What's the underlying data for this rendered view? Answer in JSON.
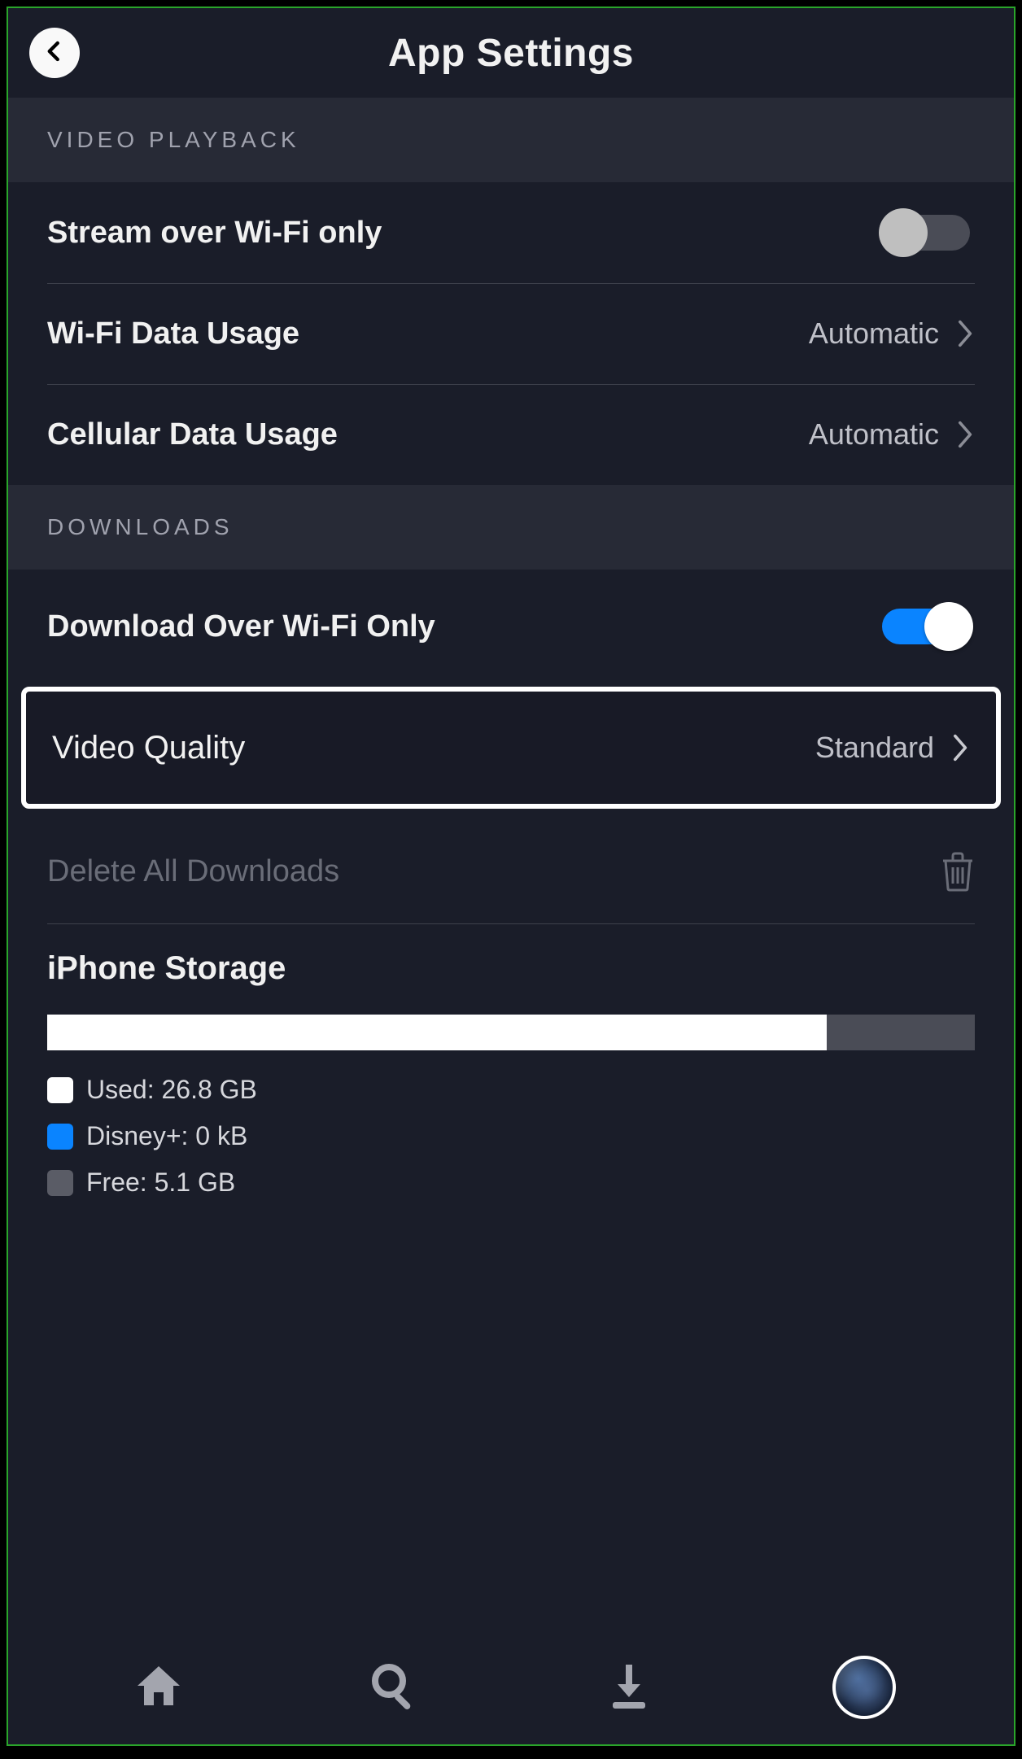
{
  "header": {
    "title": "App Settings"
  },
  "sections": {
    "videoPlayback": {
      "header": "VIDEO PLAYBACK",
      "streamWifi": {
        "label": "Stream over Wi-Fi only",
        "on": false
      },
      "wifiUsage": {
        "label": "Wi-Fi Data Usage",
        "value": "Automatic"
      },
      "cellUsage": {
        "label": "Cellular Data Usage",
        "value": "Automatic"
      }
    },
    "downloads": {
      "header": "DOWNLOADS",
      "downloadWifi": {
        "label": "Download Over Wi-Fi Only",
        "on": true
      },
      "videoQuality": {
        "label": "Video Quality",
        "value": "Standard"
      },
      "deleteAll": {
        "label": "Delete All Downloads"
      }
    }
  },
  "storage": {
    "title": "iPhone Storage",
    "usedLabel": "Used: 26.8 GB",
    "appLabel": "Disney+: 0 kB",
    "freeLabel": "Free: 5.1 GB",
    "usedPct": 84,
    "appPct": 0
  },
  "tabs": {
    "home": "home-icon",
    "search": "search-icon",
    "downloads": "download-icon",
    "profile": "profile-avatar"
  }
}
